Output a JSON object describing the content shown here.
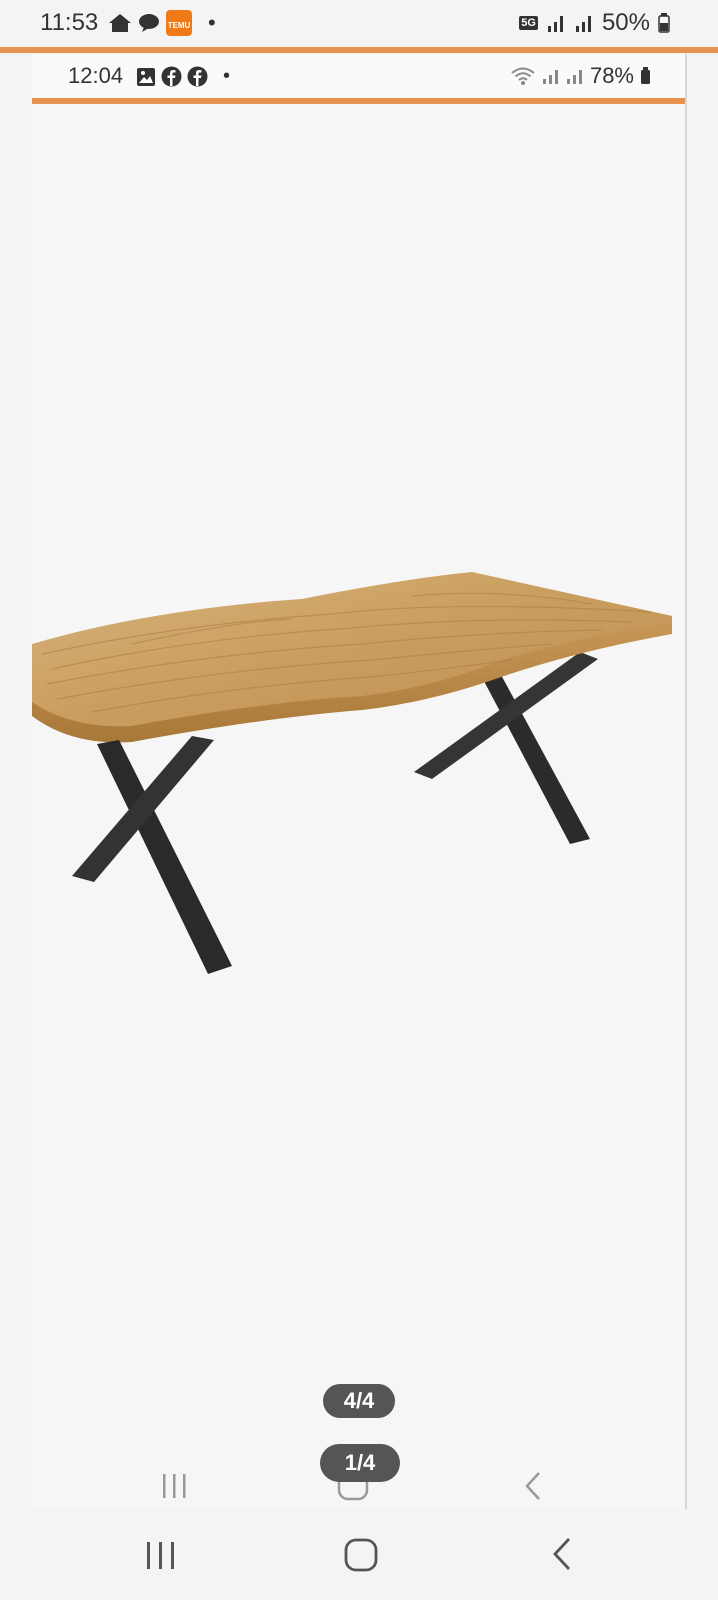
{
  "outer_status": {
    "time": "11:53",
    "notification_icons": [
      "home-icon",
      "chat-bubble-icon",
      "temu-icon"
    ],
    "temu_label": "TEMU",
    "dot": "•",
    "network": "5G",
    "battery": "50%"
  },
  "inner_status": {
    "time": "12:04",
    "notification_icons": [
      "gallery-icon",
      "facebook-icon",
      "facebook-icon"
    ],
    "dot": "•",
    "battery": "78%"
  },
  "viewer": {
    "inner_counter": "4/4",
    "outer_counter": "1/4"
  },
  "colors": {
    "accent": "#e8924f",
    "pill": "#555555",
    "wood": "#c9a064",
    "metal": "#2e2e2e"
  },
  "nav_icons": [
    "recents-icon",
    "home-icon",
    "back-icon"
  ]
}
